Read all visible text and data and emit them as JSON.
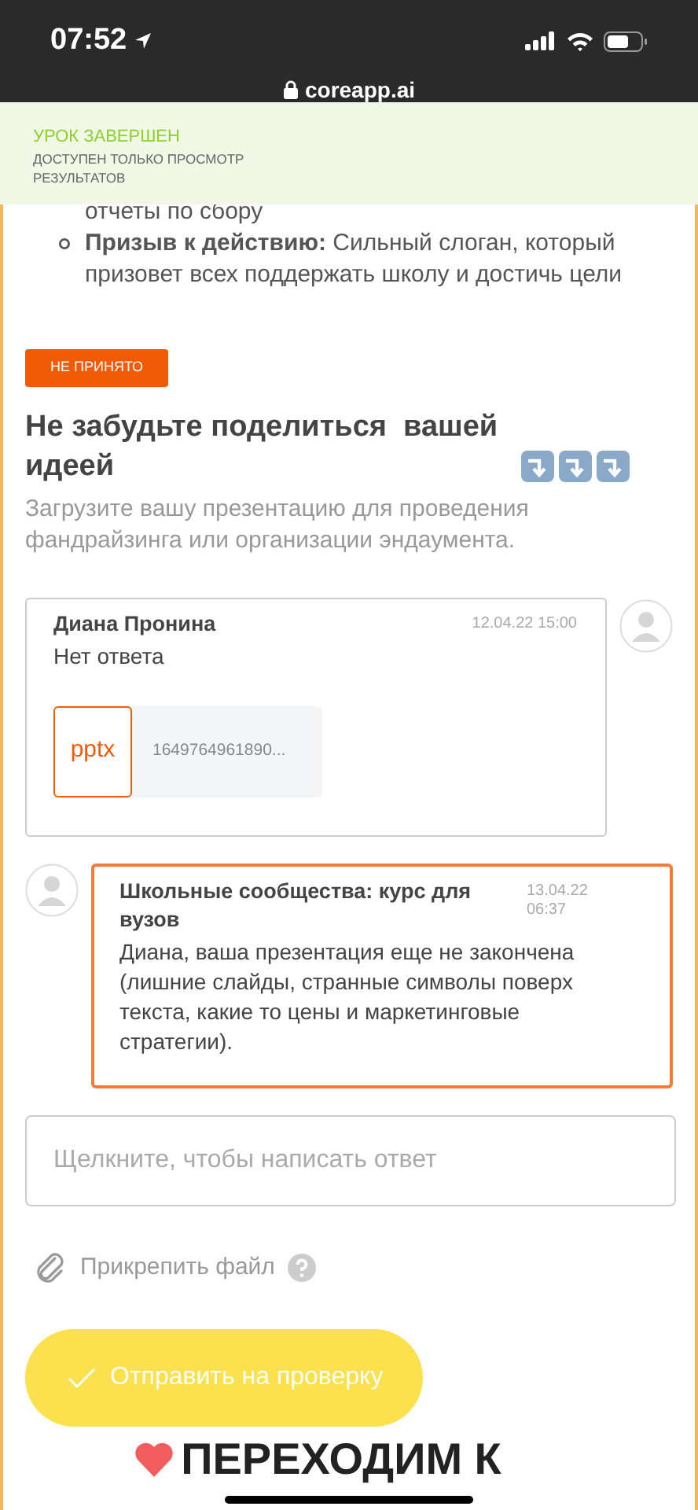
{
  "status_bar": {
    "time": "07:52",
    "url": "coreapp.ai"
  },
  "banner": {
    "title": "УРОК ЗАВЕРШЕН",
    "subtitle": "ДОСТУПЕН ТОЛЬКО ПРОСМОТР РЕЗУЛЬТАТОВ"
  },
  "lesson_text": {
    "continued_line": "отчеты по сбору",
    "bullets": [
      {
        "text": "**Призыв к действию:** Сильный слоган, который призовет всех поддержать школу и достичь цели"
      }
    ]
  },
  "task": {
    "status_badge": "НЕ ПРИНЯТО",
    "title": "Не забудьте поделиться  вашей идеей",
    "description": "Загрузите вашу презентацию для проведения фандрайзинга или организации эндаумента."
  },
  "comments": [
    {
      "kind": "student",
      "author": "Диана Пронина",
      "date": "12.04.22 15:00",
      "text": "Нет ответа",
      "attachment": {
        "type": "pptx",
        "name": "1649764961890..."
      }
    },
    {
      "kind": "reviewer",
      "author": "Школьные сообщества: курс для вузов",
      "date": "13.04.22 06:37",
      "text": "Диана, ваша презентация еще не закончена (лишние слайды, странные символы поверх текста, какие то цены и маркетинговые стратегии)."
    }
  ],
  "reply": {
    "placeholder": "Щелкните, чтобы написать ответ",
    "attach_label": "Прикрепить файл",
    "submit_button": "Отправить на проверку"
  },
  "next_heading": "ПЕРЕХОДИМ К"
}
